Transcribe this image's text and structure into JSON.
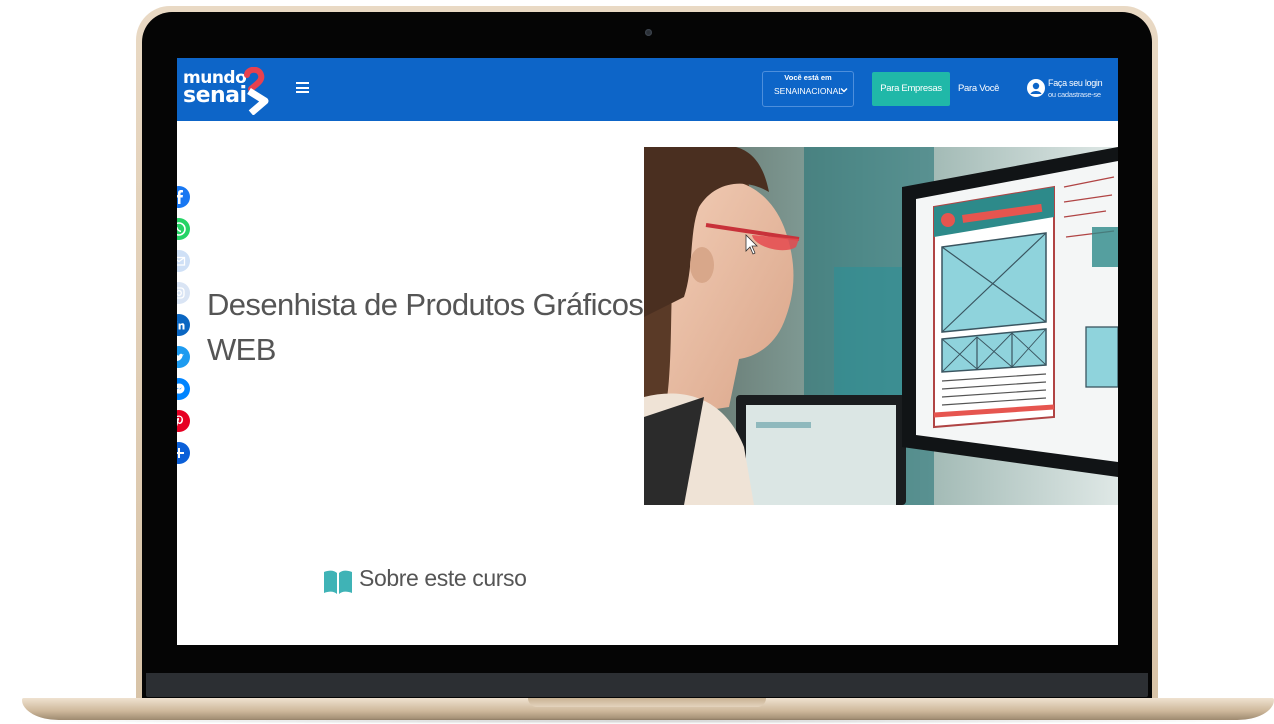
{
  "header": {
    "logo": {
      "line1": "mundo",
      "line2": "senai"
    },
    "region": {
      "caption": "Você está em",
      "value": "SENAINACIONAL"
    },
    "for_companies_label": "Para Empresas",
    "for_you_label": "Para Você",
    "login": {
      "title": "Faça seu login",
      "subtitle": "ou cadastrase-se"
    }
  },
  "social_icons": [
    "facebook-icon",
    "whatsapp-icon",
    "email-icon",
    "instagram-icon",
    "linkedin-icon",
    "twitter-icon",
    "messenger-icon",
    "pinterest-icon",
    "share-plus-icon"
  ],
  "course": {
    "title": "Desenhista de Produtos Gráficos WEB",
    "hero_image": "woman-with-glasses-looking-at-website-wireframe-on-monitor"
  },
  "section": {
    "heading": "Sobre este curso",
    "icon": "open-book-icon"
  },
  "colors": {
    "header_bg": "#0d65c8",
    "companies_button": "#20b8a8",
    "logo_accent": "#e8414f",
    "section_icon": "#3fb3b6",
    "title_text": "#555555"
  }
}
